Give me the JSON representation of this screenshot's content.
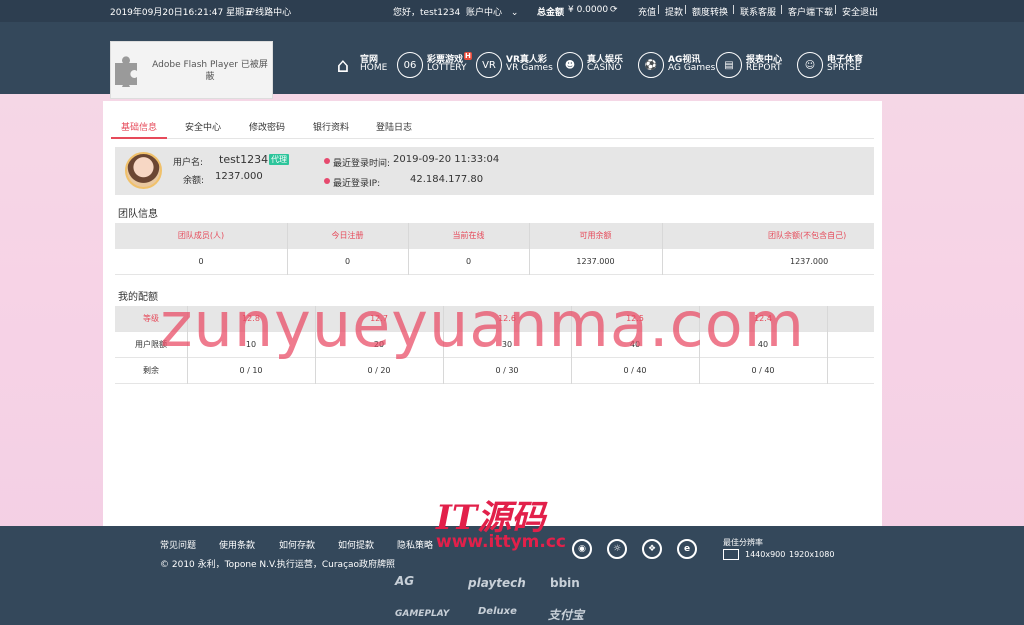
{
  "topbar": {
    "datetime": "2019年09月20日16:21:47 星期五",
    "line_center": "线路中心",
    "greeting": "您好，test1234",
    "account_center": "账户中心",
    "total_label": "总金额",
    "total_value": "¥ 0.0000",
    "links": [
      "充值",
      "提款",
      "额度转换",
      "联系客服",
      "客户端下载",
      "安全退出"
    ]
  },
  "flash_notice": "Adobe Flash Player 已被屏蔽",
  "nav": [
    {
      "zh": "官网",
      "en": "HOME",
      "icon": "home-icon"
    },
    {
      "zh": "彩票游戏",
      "en": "LOTTERY",
      "icon": "lottery-icon",
      "badge": "H"
    },
    {
      "zh": "VR真人彩",
      "en": "VR Games",
      "icon": "vr-icon"
    },
    {
      "zh": "真人娱乐",
      "en": "CASINO",
      "icon": "casino-icon"
    },
    {
      "zh": "AG视讯",
      "en": "AG Games",
      "icon": "ag-icon"
    },
    {
      "zh": "报表中心",
      "en": "REPORT",
      "icon": "report-icon"
    },
    {
      "zh": "电子体育",
      "en": "SPRTSE",
      "icon": "sports-icon"
    }
  ],
  "tabs": [
    "基础信息",
    "安全中心",
    "修改密码",
    "银行资料",
    "登陆日志"
  ],
  "user": {
    "username_label": "用户名:",
    "username": "test1234",
    "agent_badge": "代理",
    "balance_label": "余额:",
    "balance": "1237.000",
    "last_login_time_label": "最近登录时间:",
    "last_login_time": "2019-09-20 11:33:04",
    "last_login_ip_label": "最近登录IP:",
    "last_login_ip": "42.184.177.80"
  },
  "team": {
    "title": "团队信息",
    "headers": [
      "团队成员(人)",
      "今日注册",
      "当前在线",
      "可用余额",
      "团队余额(不包含自己)"
    ],
    "values": [
      "0",
      "0",
      "0",
      "1237.000",
      "1237.000"
    ]
  },
  "quota": {
    "title": "我的配额",
    "rows": [
      {
        "label": "等级",
        "values": [
          "12.8",
          "12.7",
          "12.6",
          "12.5",
          "12.4"
        ]
      },
      {
        "label": "用户限额",
        "values": [
          "10",
          "20",
          "30",
          "40",
          "40"
        ]
      },
      {
        "label": "剩余",
        "values": [
          "0 / 10",
          "0 / 20",
          "0 / 30",
          "0 / 40",
          "0 / 40"
        ]
      }
    ]
  },
  "watermark": {
    "big": "zunyueyuanma.com",
    "logo": "IT源码",
    "url": "www.ittym.cc"
  },
  "footer": {
    "links": [
      "常见问题",
      "使用条款",
      "如何存款",
      "如何提款",
      "隐私策略"
    ],
    "copyright": "© 2010 永利，Topone N.V.执行运营，Curaçao政府牌照",
    "browsers": [
      "chrome-icon",
      "firefox-icon",
      "safari-icon",
      "ie-icon"
    ],
    "resolution_title": "最佳分辨率",
    "resolutions": [
      "1440x900",
      "1920x1080"
    ],
    "partners": [
      "AG",
      "playtech",
      "bbin",
      "GAMEPLAY",
      "Deluxe",
      "支付宝"
    ]
  }
}
